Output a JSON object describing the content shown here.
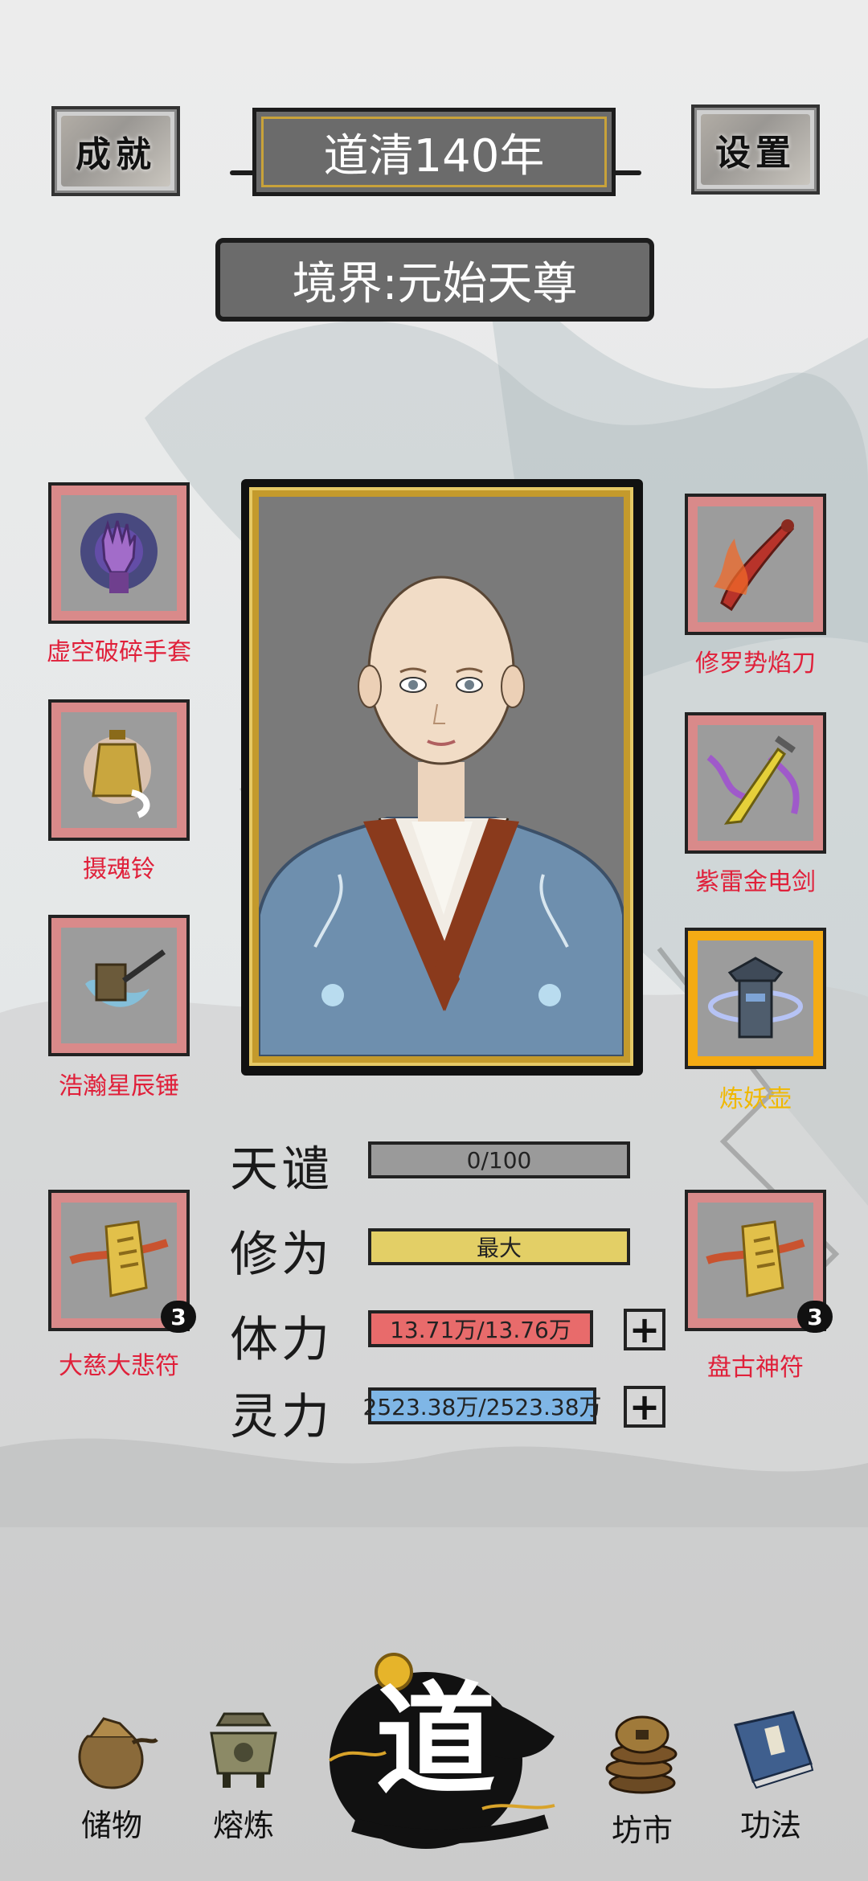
{
  "header": {
    "achievements_label": "成就",
    "settings_label": "设置",
    "year_title": "道清140年",
    "realm_title": "境界:元始天尊"
  },
  "equipment": {
    "left": [
      {
        "label": "虚空破碎手套",
        "icon": "void-gauntlet-icon"
      },
      {
        "label": "摄魂铃",
        "icon": "soul-bell-icon"
      },
      {
        "label": "浩瀚星辰锤",
        "icon": "star-hammer-icon"
      },
      {
        "label": "大慈大悲符",
        "icon": "talisman-icon",
        "count": "3"
      }
    ],
    "right": [
      {
        "label": "修罗势焰刀",
        "icon": "flame-blade-icon"
      },
      {
        "label": "紫雷金电剑",
        "icon": "thunder-sword-icon"
      },
      {
        "label": "炼妖壶",
        "icon": "demon-pot-icon",
        "highlight": true
      },
      {
        "label": "盘古神符",
        "icon": "talisman-icon",
        "count": "3"
      }
    ]
  },
  "stats": {
    "tianqian": {
      "label": "天谴",
      "value": "0/100",
      "fill": 0
    },
    "xiuwei": {
      "label": "修为",
      "value": "最大",
      "fill": 1
    },
    "tili": {
      "label": "体力",
      "value": "13.71万/13.76万",
      "fill": 0.996
    },
    "lingli": {
      "label": "灵力",
      "value": "2523.38万/2523.38万",
      "fill": 1
    }
  },
  "nav": {
    "storage": "储物",
    "smelt": "熔炼",
    "dao": "道",
    "market": "坊市",
    "skills": "功法"
  },
  "colors": {
    "slot_red": "#d98a8a",
    "slot_gold": "#f4ab14",
    "label_red": "#e0203a",
    "label_gold": "#f0b800",
    "bar_grey": "#7c7c7c",
    "bar_yellow": "#e3cf66",
    "bar_red": "#e86b6b",
    "bar_blue": "#7fb6e6"
  }
}
